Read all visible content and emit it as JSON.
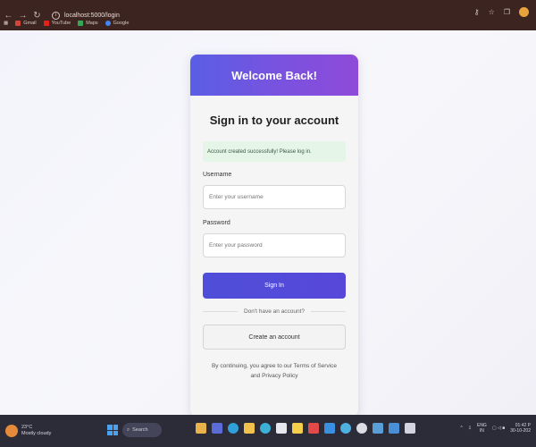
{
  "browser": {
    "url": "localhost:5000/login",
    "bookmarks": [
      {
        "label": "Gmail",
        "color": "#d44638"
      },
      {
        "label": "YouTube",
        "color": "#e62117"
      },
      {
        "label": "Maps",
        "color": "#34a853"
      },
      {
        "label": "Google",
        "color": "#4285f4"
      }
    ]
  },
  "login": {
    "header_title": "Welcome Back!",
    "title": "Sign in to your account",
    "success_message": "Account created successfully! Please log in.",
    "username_label": "Username",
    "username_placeholder": "Enter your username",
    "password_label": "Password",
    "password_placeholder": "Enter your password",
    "signin_button": "Sign In",
    "divider_text": "Don't have an account?",
    "create_account_button": "Create an account",
    "terms_text": "By continuing, you agree to our Terms of Service and Privacy Policy"
  },
  "colors": {
    "header_gradient_start": "#5a5ee4",
    "header_gradient_end": "#8f4ad9",
    "primary_button": "#5049d9",
    "success_bg": "#e5f6e8"
  },
  "taskbar": {
    "weather_temp": "23°C",
    "weather_desc": "Mostly cloudy",
    "search_label": "Search",
    "language": "ENG",
    "region": "IN",
    "time": "01:42 P",
    "date": "30-10-202"
  }
}
